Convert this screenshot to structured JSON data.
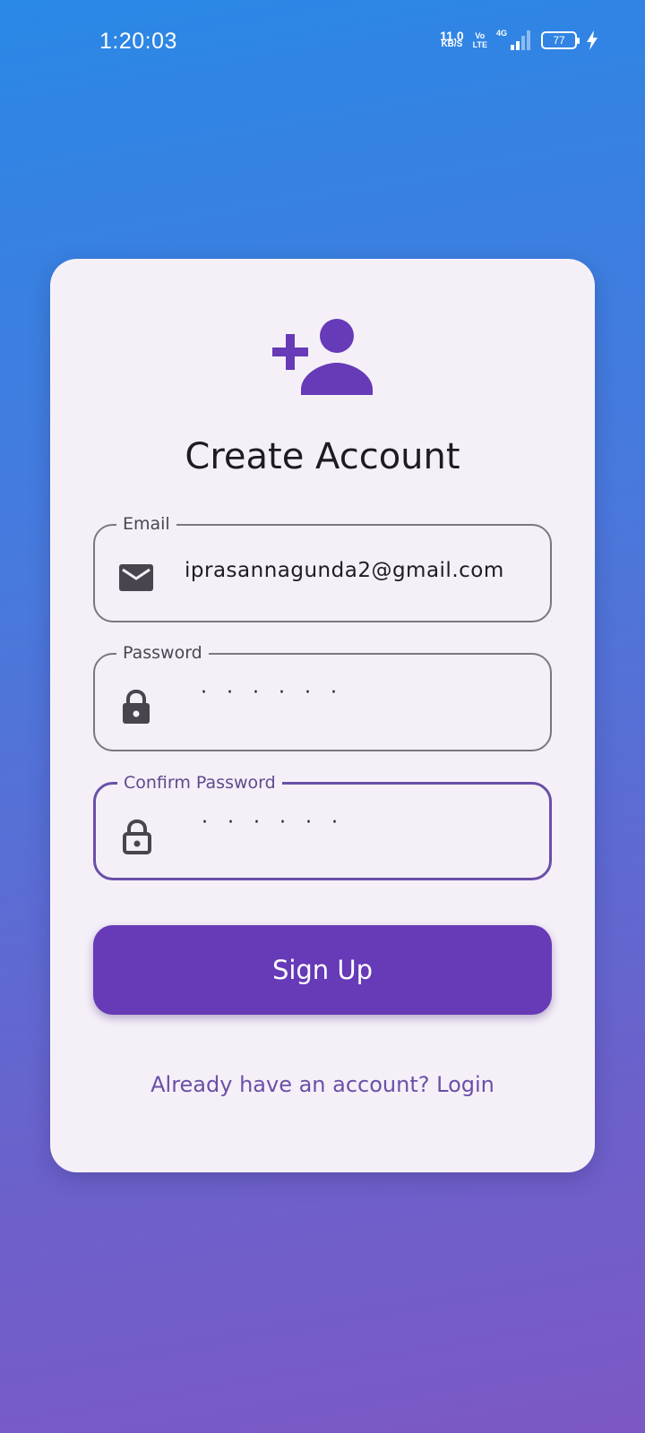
{
  "status_bar": {
    "time": "1:20:03",
    "net_speed_value": "11.0",
    "net_speed_unit": "KB/S",
    "volte_top": "Vo",
    "volte_bottom": "LTE",
    "network_type": "4G",
    "battery_level": "77"
  },
  "form": {
    "title": "Create Account",
    "header_icon": "add-user-icon",
    "email": {
      "label": "Email",
      "value": "iprasannagunda2@gmail.com",
      "icon": "mail-icon"
    },
    "password": {
      "label": "Password",
      "value": "······",
      "icon": "lock-icon"
    },
    "confirm_password": {
      "label": "Confirm Password",
      "value": "······",
      "icon": "lock-icon"
    },
    "signup_label": "Sign Up",
    "login_prompt": "Already have an account? Login"
  },
  "colors": {
    "accent": "#673ab7",
    "focus_border": "#6a4fa8",
    "card_bg": "#f5f0f8",
    "gradient_top": "#2a88e6",
    "gradient_bottom": "#7c58c4"
  }
}
